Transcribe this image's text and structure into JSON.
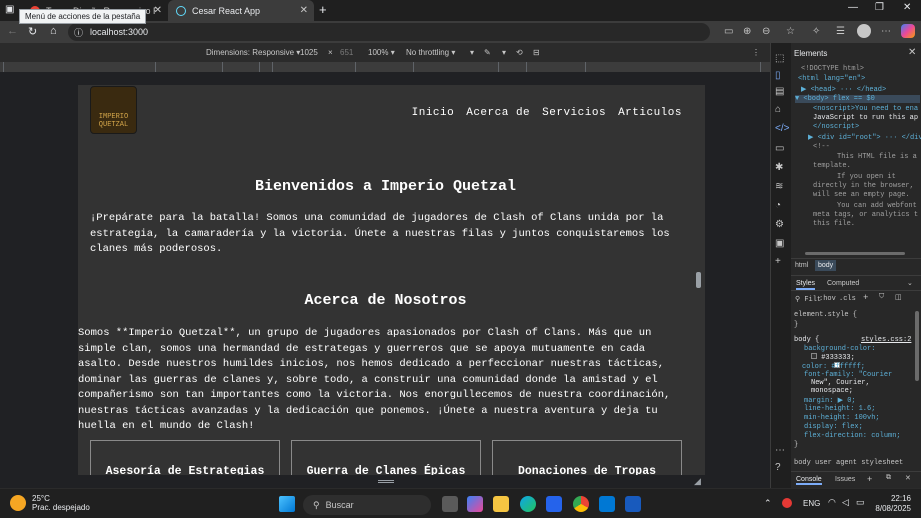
{
  "browser": {
    "tabs": [
      {
        "title": "Tema: Diseño Responsivo React.js"
      },
      {
        "title": "Cesar React App"
      }
    ],
    "tooltip": "Menú de acciones de la pestaña",
    "url": "localhost:3000"
  },
  "device_toolbar": {
    "dimensions_label": "Dimensions: Responsive",
    "width": "1025",
    "times": "×",
    "height": "651",
    "zoom": "100%",
    "throttling": "No throttling"
  },
  "site": {
    "logo_text": "IMPERIO QUETZAL",
    "nav": [
      "Inicio",
      "Acerca de",
      "Servicios",
      "Articulos"
    ],
    "welcome_title": "Bienvenidos a Imperio Quetzal",
    "welcome_text": "¡Prepárate para la batalla! Somos una comunidad de jugadores de Clash of Clans unida por la estrategia, la camaradería y la victoria. Únete a nuestras filas y juntos conquistaremos los clanes más poderosos.",
    "about_title": "Acerca de Nosotros",
    "about_text": "Somos **Imperio Quetzal**, un grupo de jugadores apasionados por Clash of Clans. Más que un simple clan, somos una hermandad de estrategas y guerreros que se apoya mutuamente en cada asalto. Desde nuestros humildes inicios, nos hemos dedicado a perfeccionar nuestras tácticas, dominar las guerras de clanes y, sobre todo, a construir una comunidad donde la amistad y el compañerismo son tan importantes como la victoria. Nos enorgullecemos de nuestra coordinación, nuestras tácticas avanzadas y la dedicación que ponemos. ¡Únete a nuestra aventura y deja tu huella en el mundo de Clash!",
    "cards": [
      "Asesoría de Estrategias",
      "Guerra de Clanes Épicas",
      "Donaciones de Tropas"
    ]
  },
  "devtools": {
    "title": "Elements",
    "lines": [
      "<!DOCTYPE html>",
      "<html lang=\"en\">",
      "▶ <head> ··· </head>",
      "▼ <body> flex == $0",
      "<noscript>You need to ena",
      "JavaScript to run this ap",
      "</noscript>",
      "▶ <div id=\"root\"> ··· </div>",
      "<!--",
      "This HTML file is a",
      "template.",
      "If you open it",
      "directly in the browser,",
      "will see an empty page.",
      "You can add webfont",
      "meta tags, or analytics t",
      "this file."
    ],
    "breadcrumbs": [
      "html",
      "body"
    ],
    "styles_tabs": [
      "Styles",
      "Computed"
    ],
    "filter_placeholder": "Filt",
    "hov": ":hov",
    "cls": ".cls",
    "element_style": "element.style {",
    "close_brace": "}",
    "body_selector": "body {",
    "stylesheet": "styles.css:2",
    "rules": [
      "background-color:",
      "#333333;",
      "color: #ffffff;",
      "font-family: \"Courier",
      "New\", Courier,",
      "monospace;",
      "margin: ▶ 0;",
      "line-height: 1.6;",
      "min-height: 100vh;",
      "display: flex;",
      "flex-direction: column;"
    ],
    "ua_label": "body   user agent stylesheet",
    "drawer_tabs": [
      "Console",
      "Issues"
    ]
  },
  "taskbar": {
    "temp": "25°C",
    "weather": "Prac. despejado",
    "search": "Buscar",
    "lang": "ENG",
    "time": "22:16",
    "date": "8/08/2025"
  }
}
